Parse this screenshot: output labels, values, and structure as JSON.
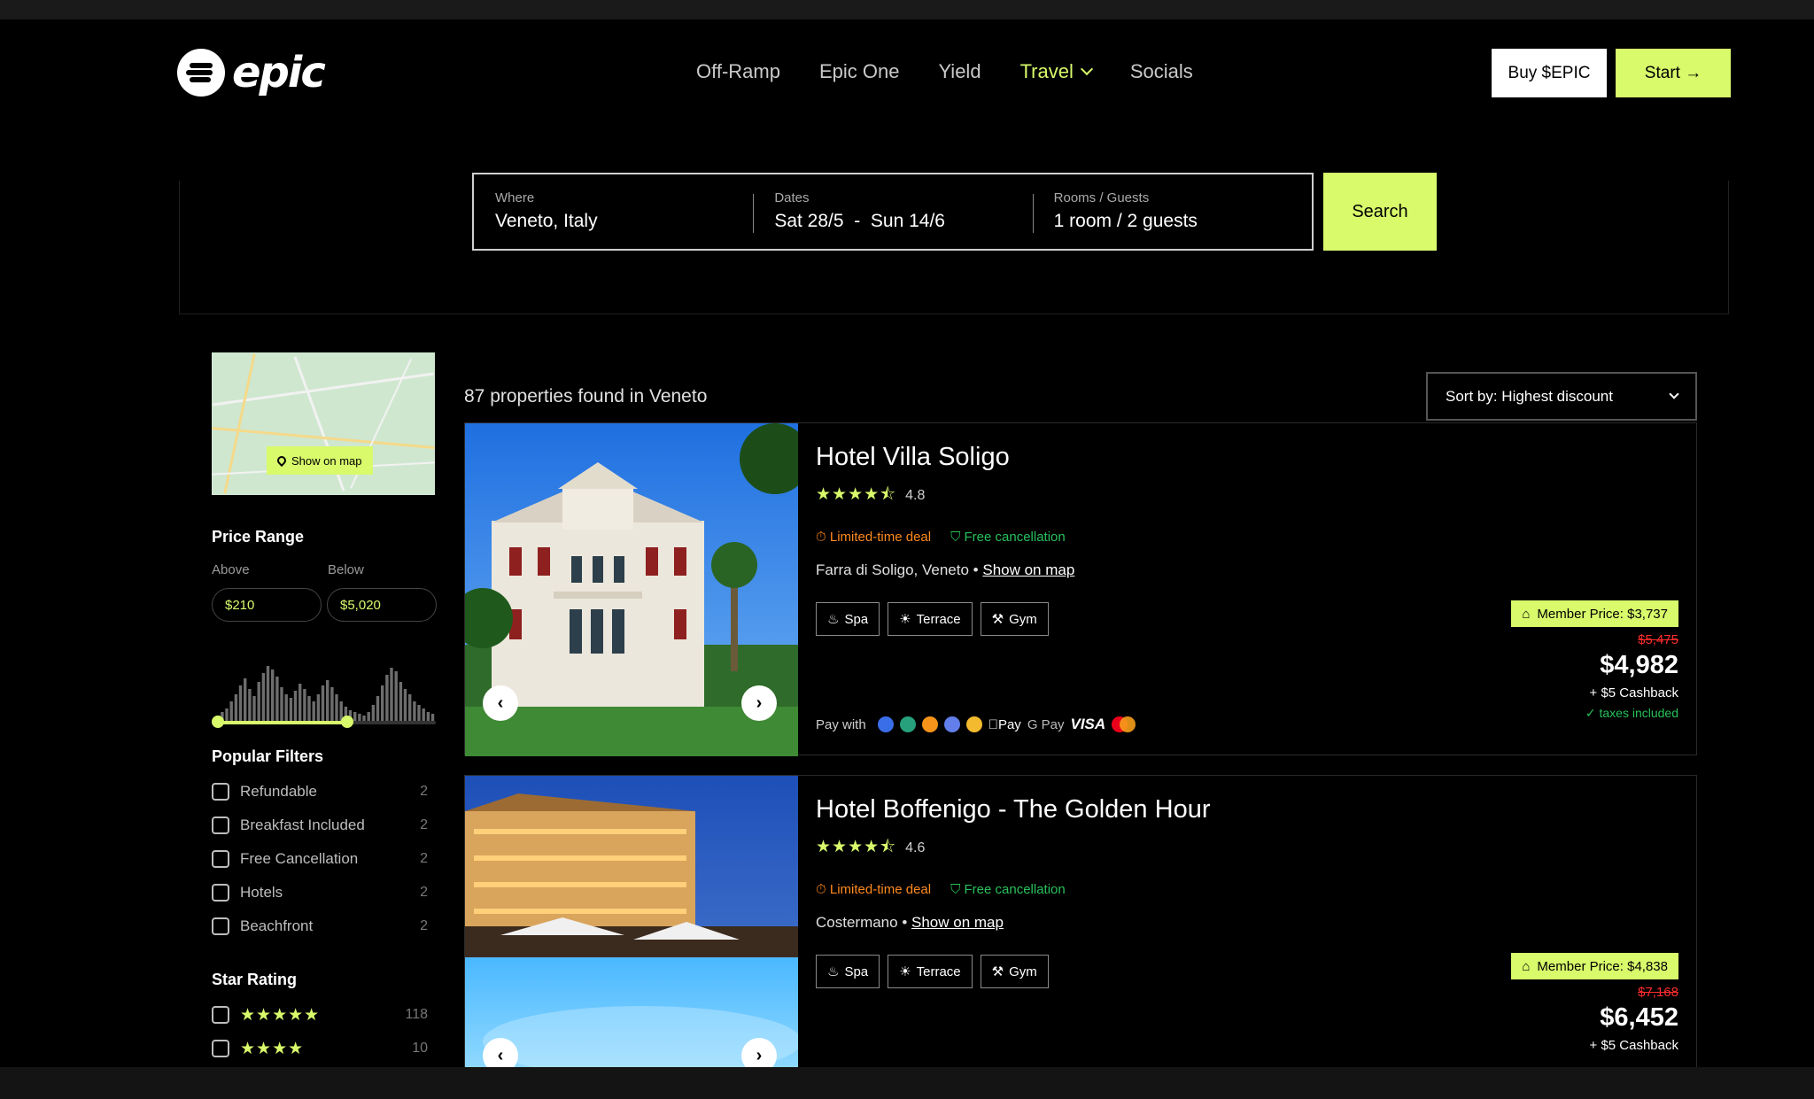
{
  "brand": {
    "name": "epic"
  },
  "nav": [
    {
      "label": "Off-Ramp"
    },
    {
      "label": "Epic One"
    },
    {
      "label": "Yield"
    },
    {
      "label": "Travel"
    },
    {
      "label": "Socials"
    }
  ],
  "buttons": {
    "buy": "Buy $EPIC",
    "start": "Start →",
    "search": "Search"
  },
  "search": {
    "where_label": "Where",
    "where_value": "Veneto, Italy",
    "dates_label": "Dates",
    "dates_value": "Sat 28/5  -  Sun 14/6",
    "rooms_label": "Rooms / Guests",
    "rooms_value": "1 room / 2 guests"
  },
  "sidebar": {
    "map_button": "Show on map",
    "price_range_title": "Price Range",
    "above_label": "Above",
    "below_label": "Below",
    "above_value": "$210",
    "below_value": "$5,020",
    "slider_selection": [
      0,
      0.59
    ],
    "popular_filters_title": "Popular Filters",
    "filters": [
      {
        "label": "Refundable",
        "count": "2"
      },
      {
        "label": "Breakfast Included",
        "count": "2"
      },
      {
        "label": "Free Cancellation",
        "count": "2"
      },
      {
        "label": "Hotels",
        "count": "2"
      },
      {
        "label": "Beachfront",
        "count": "2"
      }
    ],
    "star_rating_title": "Star Rating",
    "star_filters": [
      {
        "stars": "★★★★★",
        "count": "118"
      },
      {
        "stars": "★★★★",
        "count": "10"
      }
    ]
  },
  "results": {
    "count_text": "87 properties found in Veneto",
    "sort_label": "Sort by: Highest discount"
  },
  "hotels": [
    {
      "name": "Hotel Villa Soligo",
      "stars": "★★★★⯪",
      "rating": "4.8",
      "deal": "Limited-time deal",
      "cancellation": "Free cancellation",
      "location": "Farra di Soligo, Veneto",
      "map_link": "Show on map",
      "amenities": [
        "Spa",
        "Terrace",
        "Gym"
      ],
      "pay_label": "Pay with",
      "member_price": "Member Price: $3,737",
      "old_price": "$5,475",
      "price": "$4,982",
      "cashback": "+ $5 Cashback",
      "taxes": "taxes included"
    },
    {
      "name": "Hotel Boffenigo - The Golden Hour",
      "stars": "★★★★⯪",
      "rating": "4.6",
      "deal": "Limited-time deal",
      "cancellation": "Free cancellation",
      "location": "Costermano",
      "map_link": "Show on map",
      "amenities": [
        "Spa",
        "Terrace",
        "Gym"
      ],
      "member_price": "Member Price: $4,838",
      "old_price": "$7,168",
      "price": "$6,452",
      "cashback": "+ $5 Cashback"
    }
  ],
  "payment_methods": [
    "VISA",
    "Pay",
    "G Pay"
  ],
  "colors": {
    "accent": "#d8fa6b",
    "deal": "#ff8a1f",
    "success": "#27c15b",
    "strike": "#ff2d2d"
  }
}
